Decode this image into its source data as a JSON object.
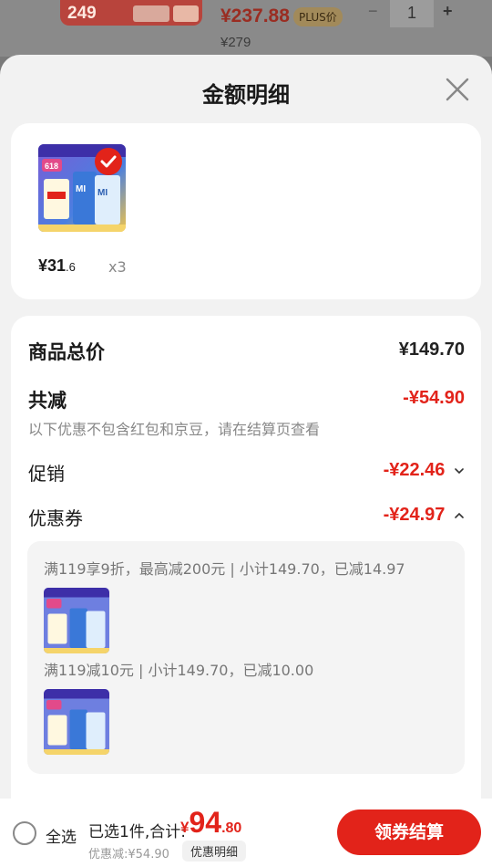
{
  "background_item": {
    "thumb_number": "249",
    "price": "¥237.88",
    "plus_badge": "PLUS价",
    "original_price": "¥279",
    "quantity": "1",
    "minus": "−",
    "plus": "+"
  },
  "sheet": {
    "title": "金额明细",
    "close_icon": "close-icon"
  },
  "product": {
    "price_int": "¥31",
    "price_dec": ".6",
    "quantity": "x3",
    "image_badge": "618"
  },
  "summary": {
    "total_label": "商品总价",
    "total_value": "¥149.70",
    "reduce_label": "共减",
    "reduce_value": "-¥54.90",
    "note": "以下优惠不包含红包和京豆，请在结算页查看",
    "promo_label": "促销",
    "promo_value": "-¥22.46",
    "coupon_label": "优惠券",
    "coupon_value": "-¥24.97"
  },
  "coupons": [
    {
      "text": "满119享9折，最高减200元 | 小计149.70，已减14.97"
    },
    {
      "text": "满119减10元 | 小计149.70，已减10.00"
    }
  ],
  "bottom": {
    "select_all": "全选",
    "selected_text": "已选1件,合计:",
    "total_symbol": "¥",
    "total_int": "94",
    "total_dec": ".80",
    "saving": "优惠减:¥54.90",
    "detail_chip": "优惠明细",
    "checkout": "领券结算"
  },
  "colors": {
    "accent_red": "#e2231a",
    "sheet_bg": "#f2f2f2"
  }
}
